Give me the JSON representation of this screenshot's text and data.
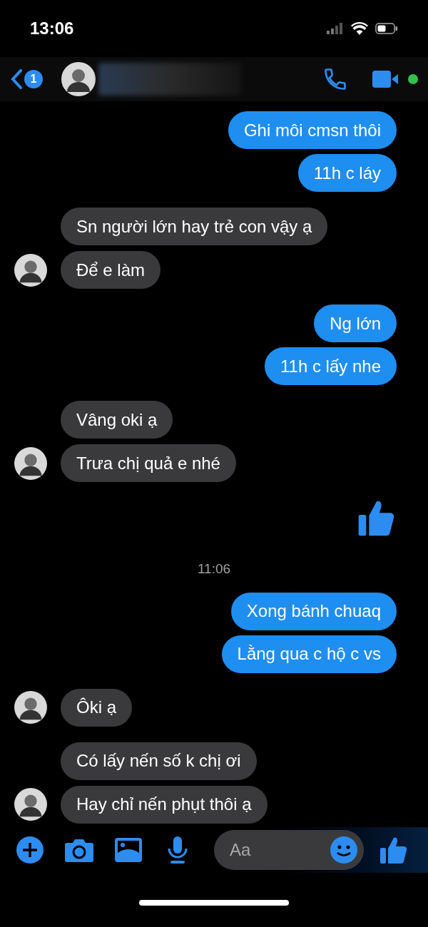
{
  "status_bar": {
    "time": "13:06"
  },
  "header": {
    "unread_badge": "1"
  },
  "messages": [
    {
      "kind": "sent",
      "texts": [
        "Ghi môi cmsn thôi",
        "11h c láy"
      ]
    },
    {
      "kind": "received",
      "texts": [
        "Sn người lớn hay trẻ con vậy ạ",
        "Để e làm"
      ]
    },
    {
      "kind": "sent",
      "texts": [
        "Ng lớn",
        "11h c lấy nhe"
      ]
    },
    {
      "kind": "received",
      "texts": [
        "Vâng oki ạ",
        "Trưa chị quả e nhé"
      ]
    },
    {
      "kind": "like"
    },
    {
      "kind": "timestamp",
      "text": "11:06"
    },
    {
      "kind": "sent",
      "texts": [
        "Xong bánh chuaq",
        "Lằng qua c hộ c vs"
      ]
    },
    {
      "kind": "received",
      "texts": [
        "Ôki ạ"
      ]
    },
    {
      "kind": "received",
      "texts": [
        "Có lấy nến số k chị ơi",
        "Hay chỉ nến phụt thôi ạ"
      ]
    }
  ],
  "composer": {
    "placeholder": "Aa"
  }
}
